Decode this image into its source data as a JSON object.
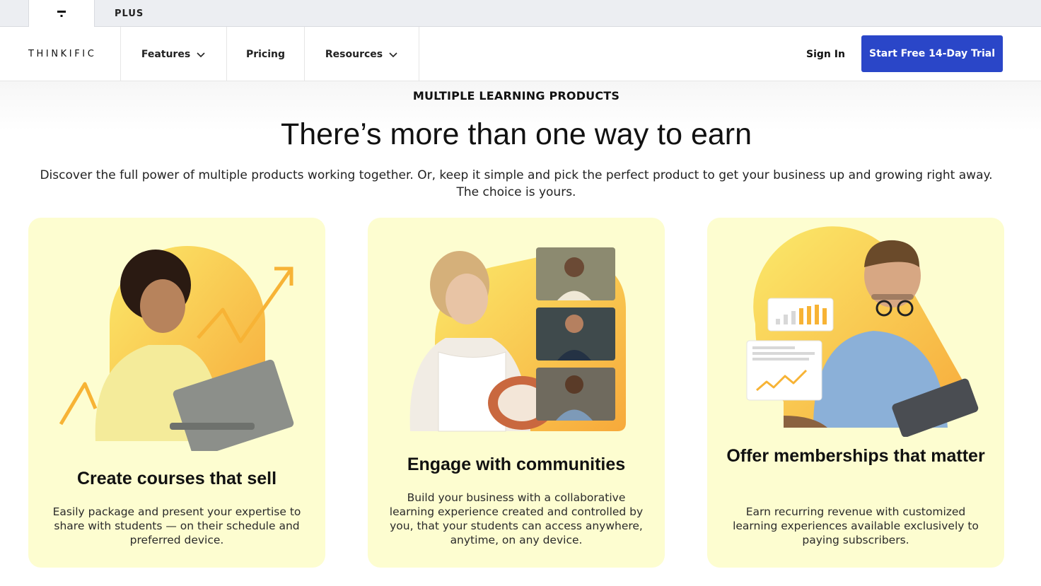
{
  "top_tabs": {
    "plus_label": "PLUS"
  },
  "nav": {
    "logo": "THINKIFIC",
    "features": "Features",
    "pricing": "Pricing",
    "resources": "Resources",
    "sign_in": "Sign In",
    "cta": "Start Free 14-Day Trial"
  },
  "hero": {
    "eyebrow": "MULTIPLE LEARNING PRODUCTS",
    "headline": "There’s more than one way to earn",
    "subtext": "Discover the full power of multiple products working together. Or, keep it simple and pick the perfect product to get your business up and growing right away. The choice is yours."
  },
  "cards": [
    {
      "title": "Create courses that sell",
      "body": "Easily package and present your expertise to share with students — on their schedule and preferred device."
    },
    {
      "title": "Engage with communities",
      "body": "Build your business with a collaborative learning experience created and controlled by you, that your students can access anywhere, anytime, on any device."
    },
    {
      "title": "Offer memberships that matter",
      "body": "Earn recurring revenue with customized learning experiences available exclusively to paying subscribers."
    }
  ],
  "colors": {
    "cta_blue": "#2a46c8",
    "card_bg": "#fdfdd0",
    "accent_orange": "#f7b335",
    "accent_yellow": "#fbe366"
  }
}
